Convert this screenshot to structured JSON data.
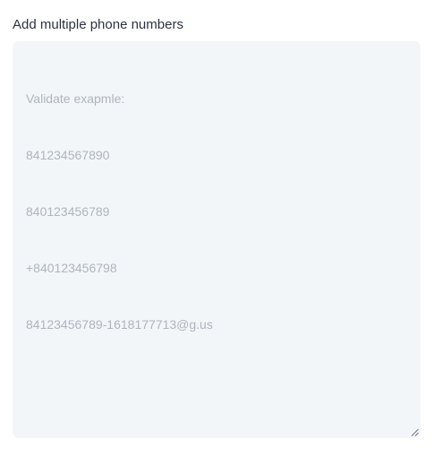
{
  "field": {
    "label": "Add multiple phone numbers",
    "placeholder_lines": [
      "Validate exapmle:",
      "841234567890",
      "840123456789",
      "+840123456798",
      "84123456789-1618177713@g.us"
    ]
  },
  "colors": {
    "label": "#2d3340",
    "textarea_bg": "#f3f6f9",
    "placeholder": "#adb5bd"
  },
  "icons": {
    "resize_handle": "resize-grip-icon"
  }
}
